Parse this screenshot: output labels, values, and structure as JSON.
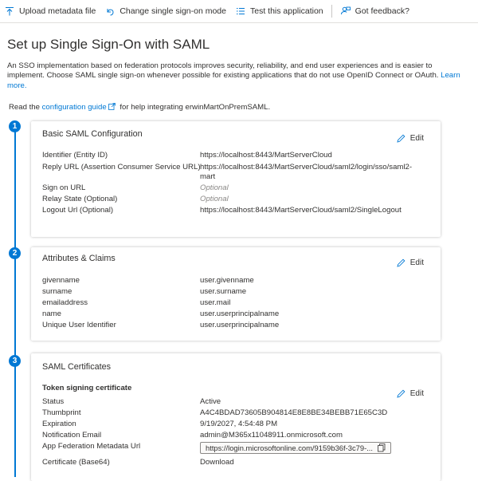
{
  "toolbar": {
    "upload": "Upload metadata file",
    "change": "Change single sign-on mode",
    "test": "Test this application",
    "feedback": "Got feedback?"
  },
  "title": "Set up Single Sign-On with SAML",
  "intro": {
    "text": "An SSO implementation based on federation protocols improves security, reliability, and end user experiences and is easier to implement. Choose SAML single sign-on whenever possible for existing applications that do not use OpenID Connect or OAuth.",
    "learn_more": "Learn more."
  },
  "read": {
    "prefix": "Read the",
    "link": "configuration guide",
    "suffix": "for help integrating erwinMartOnPremSAML."
  },
  "edit_label": "Edit",
  "steps": {
    "s1": "1",
    "s2": "2",
    "s3": "3"
  },
  "basic": {
    "title": "Basic SAML Configuration",
    "rows": [
      {
        "label": "Identifier (Entity ID)",
        "value": "https://localhost:8443/MartServerCloud"
      },
      {
        "label": "Reply URL (Assertion Consumer Service URL)",
        "value": "https://localhost:8443/MartServerCloud/saml2/login/sso/saml2-mart"
      },
      {
        "label": "Sign on URL",
        "value": "Optional"
      },
      {
        "label": "Relay State (Optional)",
        "value": "Optional"
      },
      {
        "label": "Logout Url (Optional)",
        "value": "https://localhost:8443/MartServerCloud/saml2/SingleLogout"
      }
    ]
  },
  "attributes": {
    "title": "Attributes & Claims",
    "rows": [
      {
        "label": "givenname",
        "value": "user.givenname"
      },
      {
        "label": "surname",
        "value": "user.surname"
      },
      {
        "label": "emailaddress",
        "value": "user.mail"
      },
      {
        "label": "name",
        "value": "user.userprincipalname"
      },
      {
        "label": "Unique User Identifier",
        "value": "user.userprincipalname"
      }
    ]
  },
  "certs": {
    "title": "SAML Certificates",
    "subtitle": "Token signing certificate",
    "rows": [
      {
        "label": "Status",
        "value": "Active"
      },
      {
        "label": "Thumbprint",
        "value": "A4C4BDAD73605B904814E8E8BE34BEBB71E65C3D"
      },
      {
        "label": "Expiration",
        "value": "9/19/2027, 4:54:48 PM"
      },
      {
        "label": "Notification Email",
        "value": "admin@M365x11048911.onmicrosoft.com"
      },
      {
        "label": "App Federation Metadata Url",
        "value": "https://login.microsoftonline.com/9159b36f-3c79-..."
      },
      {
        "label": "Certificate (Base64)",
        "value": "Download"
      }
    ]
  },
  "colors": {
    "accent": "#0078d4",
    "text": "#323130",
    "muted": "#8a8886"
  }
}
